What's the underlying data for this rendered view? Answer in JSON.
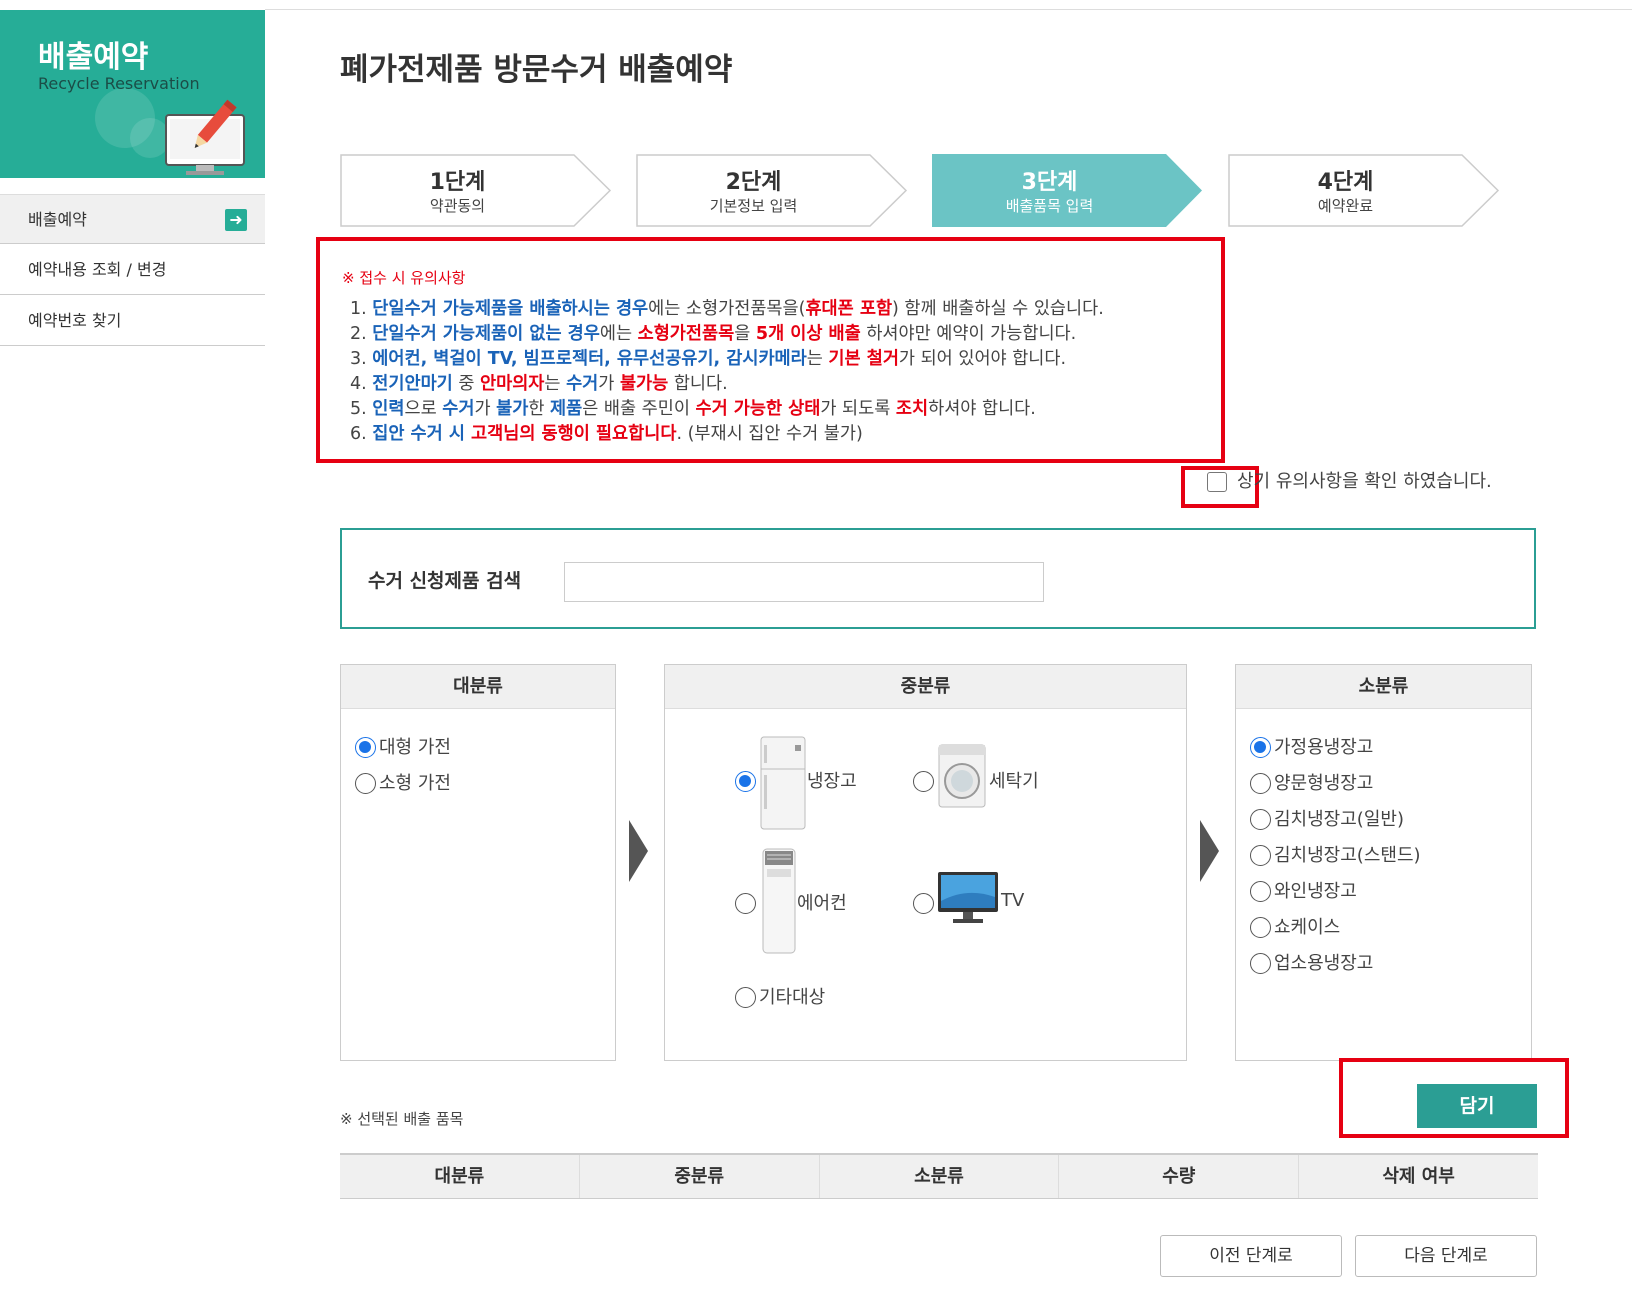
{
  "sidebar": {
    "banner_title": "배출예약",
    "banner_subtitle": "Recycle Reservation",
    "items": [
      {
        "label": "배출예약"
      },
      {
        "label": "예약내용 조회 / 변경"
      },
      {
        "label": "예약번호 찾기"
      }
    ]
  },
  "page_title": "폐가전제품 방문수거 배출예약",
  "steps": [
    {
      "title": "1단계",
      "sub": "약관동의"
    },
    {
      "title": "2단계",
      "sub": "기본정보 입력"
    },
    {
      "title": "3단계",
      "sub": "배출품목 입력"
    },
    {
      "title": "4단계",
      "sub": "예약완료"
    }
  ],
  "notice": {
    "heading": "※ 접수 시 유의사항",
    "lines": [
      [
        "1. ",
        "단일수거 가능제품을 배출하시는 경우",
        "에는 소형가전품목을(",
        "휴대폰 포함",
        ") 함께 배출하실 수 있습니다."
      ],
      [
        "2. ",
        "단일수거 가능제품이 없는 경우",
        "에는 ",
        "소형가전품목",
        "을 ",
        "5개 이상 배출",
        " 하셔야만 예약이 가능합니다."
      ],
      [
        "3. ",
        "에어컨, 벽걸이 TV, 빔프로젝터, 유무선공유기, 감시카메라",
        "는 ",
        "기본 철거",
        "가 되어 있어야 합니다."
      ],
      [
        "4. ",
        "전기안마기",
        " 중 ",
        "안마의자",
        "는 ",
        "수거",
        "가 ",
        "불가능",
        " 합니다."
      ],
      [
        "5. ",
        "인력",
        "으로 ",
        "수거",
        "가 ",
        "불가",
        "한 ",
        "제품",
        "은 배출 주민이 ",
        "수거 가능한 상태",
        "가 되도록 ",
        "조치",
        "하셔야 합니다."
      ],
      [
        "6. ",
        "집안 수거 시 ",
        "고객님의 동행이 필요합니다",
        ". (부재시 집안 수거 불가)"
      ]
    ]
  },
  "confirm_label": "상기 유의사항을 확인 하였습니다.",
  "search": {
    "label": "수거 신청제품 검색",
    "value": "",
    "placeholder": ""
  },
  "categories": {
    "large": {
      "header": "대분류",
      "options": [
        {
          "label": "대형 가전",
          "selected": true
        },
        {
          "label": "소형 가전",
          "selected": false
        }
      ]
    },
    "mid": {
      "header": "중분류",
      "options": [
        {
          "label": "냉장고",
          "icon": "refrigerator-icon",
          "selected": true
        },
        {
          "label": "세탁기",
          "icon": "washing-machine-icon",
          "selected": false
        },
        {
          "label": "에어컨",
          "icon": "air-conditioner-icon",
          "selected": false
        },
        {
          "label": "TV",
          "icon": "tv-icon",
          "selected": false
        },
        {
          "label": "기타대상",
          "selected": false
        }
      ]
    },
    "small": {
      "header": "소분류",
      "options": [
        {
          "label": "가정용냉장고",
          "selected": true
        },
        {
          "label": "양문형냉장고",
          "selected": false
        },
        {
          "label": "김치냉장고(일반)",
          "selected": false
        },
        {
          "label": "김치냉장고(스탠드)",
          "selected": false
        },
        {
          "label": "와인냉장고",
          "selected": false
        },
        {
          "label": "쇼케이스",
          "selected": false
        },
        {
          "label": "업소용냉장고",
          "selected": false
        }
      ]
    }
  },
  "add_button": "담기",
  "selected_title": "※ 선택된 배출 품목",
  "table_headers": [
    "대분류",
    "중분류",
    "소분류",
    "수량",
    "삭제 여부"
  ],
  "buttons": {
    "prev": "이전 단계로",
    "next": "다음 단계로"
  },
  "colors": {
    "accent": "#26ad97",
    "step_active": "#6bc4c5",
    "button": "#2b9e94",
    "highlight": "#e60012",
    "blue_text": "#1a63b8"
  }
}
